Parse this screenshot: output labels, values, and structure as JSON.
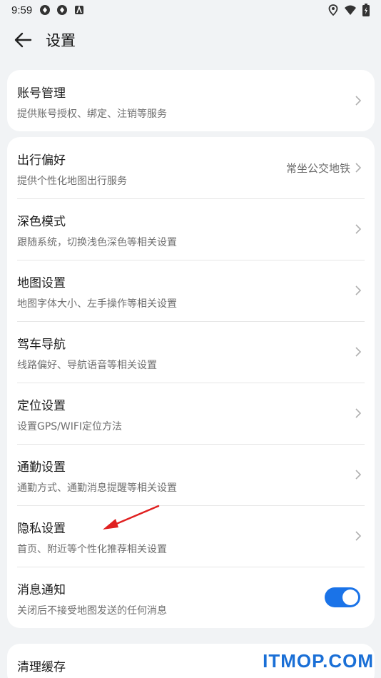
{
  "status_bar": {
    "time": "9:59",
    "icons_left": [
      "app-icon-1",
      "app-icon-2",
      "accessibility-icon"
    ],
    "icons_right": [
      "location-icon",
      "wifi-icon",
      "battery-icon"
    ]
  },
  "header": {
    "title": "设置"
  },
  "sections": [
    {
      "items": [
        {
          "title": "账号管理",
          "subtitle": "提供账号授权、绑定、注销等服务",
          "value": ""
        }
      ]
    },
    {
      "items": [
        {
          "title": "出行偏好",
          "subtitle": "提供个性化地图出行服务",
          "value": "常坐公交地铁"
        },
        {
          "title": "深色模式",
          "subtitle": "跟随系统，切换浅色深色等相关设置",
          "value": ""
        },
        {
          "title": "地图设置",
          "subtitle": "地图字体大小、左手操作等相关设置",
          "value": ""
        },
        {
          "title": "驾车导航",
          "subtitle": "线路偏好、导航语音等相关设置",
          "value": ""
        },
        {
          "title": "定位设置",
          "subtitle": "设置GPS/WIFI定位方法",
          "value": ""
        },
        {
          "title": "通勤设置",
          "subtitle": "通勤方式、通勤消息提醒等相关设置",
          "value": ""
        },
        {
          "title": "隐私设置",
          "subtitle": "首页、附近等个性化推荐相关设置",
          "value": ""
        },
        {
          "title": "消息通知",
          "subtitle": "关闭后不接受地图发送的任何消息",
          "toggle": true
        }
      ]
    },
    {
      "items": [
        {
          "title": "清理缓存",
          "subtitle": "",
          "value": ""
        }
      ]
    }
  ],
  "colors": {
    "background": "#f1f3f5",
    "toggle_on": "#1a73e8",
    "annotation_arrow": "#e02020"
  },
  "watermark": "ITMOP.COM"
}
